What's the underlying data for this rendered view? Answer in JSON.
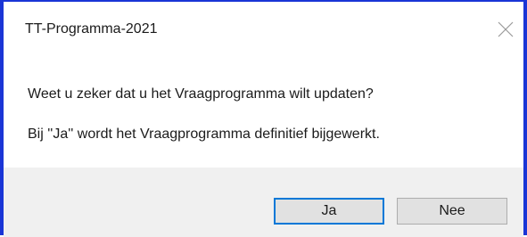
{
  "dialog": {
    "title": "TT-Programma-2021",
    "close_icon": "close-icon",
    "message_line1": "Weet u zeker dat u het Vraagprogramma wilt updaten?",
    "message_line2": "Bij ''Ja'' wordt het Vraagprogramma definitief bijgewerkt.",
    "buttons": {
      "yes_label": "Ja",
      "no_label": "Nee"
    },
    "colors": {
      "accent_border": "#1a35d6",
      "default_button_focus": "#0078d7",
      "footer_background": "#f0f0f0"
    }
  }
}
